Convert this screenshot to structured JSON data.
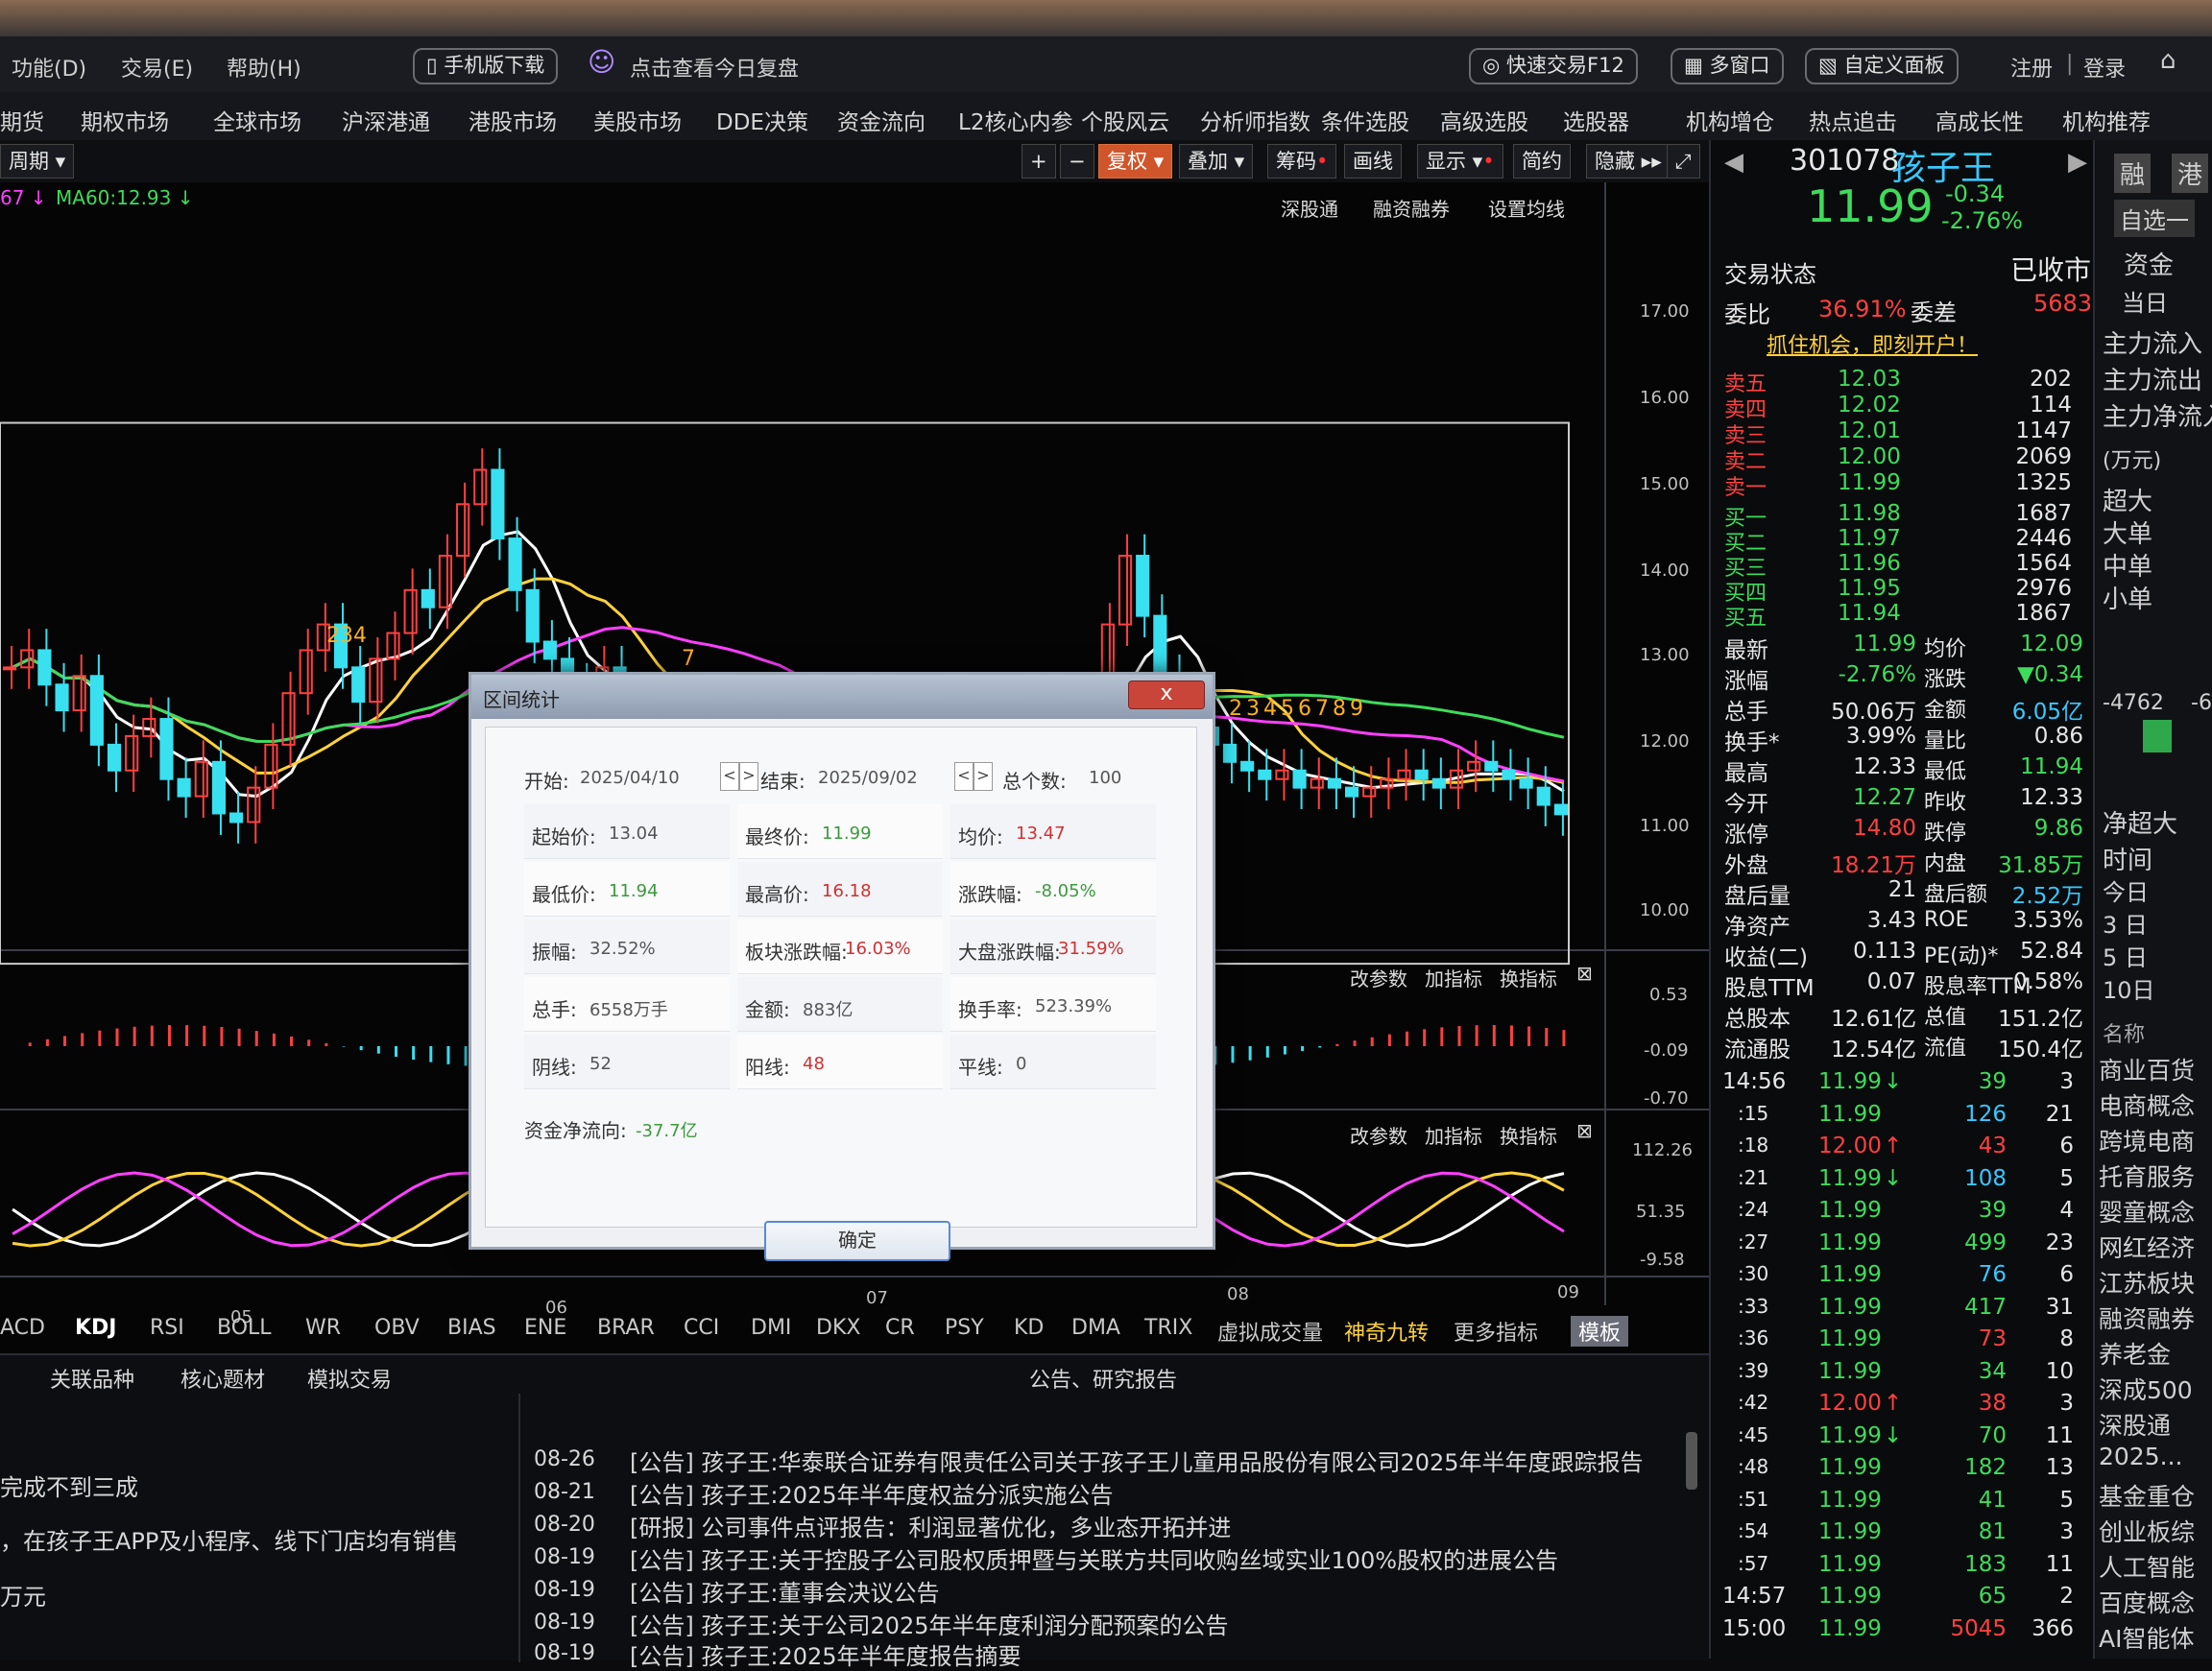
{
  "topmenu": {
    "func": "功能(D)",
    "trade": "交易(E)",
    "help": "帮助(H)",
    "mobile_download": "手机版下载",
    "review": "点击查看今日复盘",
    "quick_trade": "快速交易F12",
    "multi_window": "多窗口",
    "custom_panel": "自定义面板",
    "register": "注册",
    "login": "登录"
  },
  "nav": {
    "items": [
      "期货",
      "期权市场",
      "全球市场",
      "沪深港通",
      "港股市场",
      "美股市场",
      "DDE决策",
      "资金流向",
      "L2核心内参",
      "个股风云",
      "分析师指数",
      "条件选股",
      "高级选股",
      "选股器",
      "机构增仓",
      "热点追击",
      "高成长性",
      "机构推荐"
    ]
  },
  "toolbar": {
    "period": "周期",
    "fuquan": "复权",
    "overlay": "叠加",
    "chips": "筹码",
    "drawline": "画线",
    "display": "显示",
    "simple": "简约",
    "hide": "隐藏",
    "ma60": "MA60:12.93",
    "ma_prev": "67",
    "links": [
      "深股通",
      "融资融券",
      "设置均线"
    ]
  },
  "chart": {
    "price_ticks": [
      "17.00",
      "16.00",
      "15.00",
      "14.00",
      "13.00",
      "12.00",
      "11.00",
      "10.00"
    ],
    "macd_ticks": [
      "0.53",
      "-0.09",
      "-0.70"
    ],
    "kdj_ticks": [
      "112.26",
      "51.35",
      "-9.58"
    ],
    "x_ticks": [
      "05",
      "06",
      "07",
      "08",
      "09"
    ],
    "nine_turn_a": "234",
    "nine_turn_a2": "7",
    "nine_turn_b": "23456789",
    "sub_ops": [
      "改参数",
      "加指标",
      "换指标"
    ]
  },
  "indicator_tabs": [
    "ACD",
    "KDJ",
    "RSI",
    "BOLL",
    "WR",
    "OBV",
    "BIAS",
    "ENE",
    "BRAR",
    "CCI",
    "DMI",
    "DKX",
    "CR",
    "PSY",
    "KD",
    "DMA",
    "TRIX",
    "虚拟成交量",
    "神奇九转",
    "更多指标",
    "模板"
  ],
  "bottom": {
    "tabs": [
      "关联品种",
      "核心题材",
      "模拟交易"
    ],
    "left_text": [
      "完成不到三成",
      "，在孩子王APP及小程序、线下门店均有销售",
      "万元"
    ],
    "section_title": "公告、研究报告",
    "news": [
      {
        "date": "08-26",
        "text": "[公告] 孩子王:华泰联合证券有限责任公司关于孩子王儿童用品股份有限公司2025年半年度跟踪报告"
      },
      {
        "date": "08-21",
        "text": "[公告] 孩子王:2025年半年度权益分派实施公告"
      },
      {
        "date": "08-20",
        "text": "[研报] 公司事件点评报告：利润显著优化，多业态开拓并进"
      },
      {
        "date": "08-19",
        "text": "[公告] 孩子王:关于控股子公司股权质押暨与关联方共同收购丝域实业100%股权的进展公告"
      },
      {
        "date": "08-19",
        "text": "[公告] 孩子王:董事会决议公告"
      },
      {
        "date": "08-19",
        "text": "[公告] 孩子王:关于公司2025年半年度利润分配预案的公告"
      },
      {
        "date": "08-19",
        "text": "[公告] 孩子王:2025年半年度报告摘要"
      }
    ]
  },
  "stock": {
    "code": "301078",
    "name": "孩子王",
    "price": "11.99",
    "change": "-0.34",
    "change_pct": "-2.76%",
    "trade_status_label": "交易状态",
    "trade_status": "已收市",
    "weibi_label": "委比",
    "weibi": "36.91%",
    "weicha_label": "委差",
    "weicha": "5683",
    "promo": "抓住机会，即刻开户！",
    "asks": [
      {
        "label": "卖五",
        "price": "12.03",
        "vol": "202"
      },
      {
        "label": "卖四",
        "price": "12.02",
        "vol": "114"
      },
      {
        "label": "卖三",
        "price": "12.01",
        "vol": "1147"
      },
      {
        "label": "卖二",
        "price": "12.00",
        "vol": "2069"
      },
      {
        "label": "卖一",
        "price": "11.99",
        "vol": "1325"
      }
    ],
    "bids": [
      {
        "label": "买一",
        "price": "11.98",
        "vol": "1687"
      },
      {
        "label": "买二",
        "price": "11.97",
        "vol": "2446"
      },
      {
        "label": "买三",
        "price": "11.96",
        "vol": "1564"
      },
      {
        "label": "买四",
        "price": "11.95",
        "vol": "2976"
      },
      {
        "label": "买五",
        "price": "11.94",
        "vol": "1867"
      }
    ],
    "stats": [
      {
        "l1": "最新",
        "v1": "11.99",
        "l2": "均价",
        "v2": "12.09",
        "c1": "grn",
        "c2": "grn"
      },
      {
        "l1": "涨幅",
        "v1": "-2.76%",
        "l2": "涨跌",
        "v2": "▼0.34",
        "c1": "grn",
        "c2": "grn"
      },
      {
        "l1": "总手",
        "v1": "50.06万",
        "l2": "金额",
        "v2": "6.05亿",
        "c1": "wht",
        "c2": "cyan"
      },
      {
        "l1": "换手*",
        "v1": "3.99%",
        "l2": "量比",
        "v2": "0.86",
        "c1": "wht",
        "c2": "wht"
      },
      {
        "l1": "最高",
        "v1": "12.33",
        "l2": "最低",
        "v2": "11.94",
        "c1": "wht",
        "c2": "grn"
      },
      {
        "l1": "今开",
        "v1": "12.27",
        "l2": "昨收",
        "v2": "12.33",
        "c1": "grn",
        "c2": "wht"
      },
      {
        "l1": "涨停",
        "v1": "14.80",
        "l2": "跌停",
        "v2": "9.86",
        "c1": "red",
        "c2": "grn"
      },
      {
        "l1": "外盘",
        "v1": "18.21万",
        "l2": "内盘",
        "v2": "31.85万",
        "c1": "red",
        "c2": "grn"
      },
      {
        "l1": "盘后量",
        "v1": "21",
        "l2": "盘后额",
        "v2": "2.52万",
        "c1": "wht",
        "c2": "cyan"
      },
      {
        "l1": "净资产",
        "v1": "3.43",
        "l2": "ROE",
        "v2": "3.53%",
        "c1": "wht",
        "c2": "wht"
      },
      {
        "l1": "收益(二)",
        "v1": "0.113",
        "l2": "PE(动)*",
        "v2": "52.84",
        "c1": "wht",
        "c2": "wht"
      },
      {
        "l1": "股息TTM",
        "v1": "0.07",
        "l2": "股息率TTM",
        "v2": "0.58%",
        "c1": "wht",
        "c2": "wht"
      },
      {
        "l1": "总股本",
        "v1": "12.61亿",
        "l2": "总值",
        "v2": "151.2亿",
        "c1": "wht",
        "c2": "wht"
      },
      {
        "l1": "流通股",
        "v1": "12.54亿",
        "l2": "流值",
        "v2": "150.4亿",
        "c1": "wht",
        "c2": "wht"
      }
    ],
    "ticks": [
      {
        "t": "14:56",
        "p": "11.99",
        "a": "↓",
        "v": "39",
        "n": "3",
        "pc": "grn",
        "vc": "grn"
      },
      {
        "t": ":15",
        "p": "11.99",
        "a": "",
        "v": "126",
        "n": "21",
        "pc": "grn",
        "vc": "cyan"
      },
      {
        "t": ":18",
        "p": "12.00",
        "a": "↑",
        "v": "43",
        "n": "6",
        "pc": "red",
        "vc": "red"
      },
      {
        "t": ":21",
        "p": "11.99",
        "a": "↓",
        "v": "108",
        "n": "5",
        "pc": "grn",
        "vc": "cyan"
      },
      {
        "t": ":24",
        "p": "11.99",
        "a": "",
        "v": "39",
        "n": "4",
        "pc": "grn",
        "vc": "grn"
      },
      {
        "t": ":27",
        "p": "11.99",
        "a": "",
        "v": "499",
        "n": "23",
        "pc": "grn",
        "vc": "grn"
      },
      {
        "t": ":30",
        "p": "11.99",
        "a": "",
        "v": "76",
        "n": "6",
        "pc": "grn",
        "vc": "cyan"
      },
      {
        "t": ":33",
        "p": "11.99",
        "a": "",
        "v": "417",
        "n": "31",
        "pc": "grn",
        "vc": "grn"
      },
      {
        "t": ":36",
        "p": "11.99",
        "a": "",
        "v": "73",
        "n": "8",
        "pc": "grn",
        "vc": "red"
      },
      {
        "t": ":39",
        "p": "11.99",
        "a": "",
        "v": "34",
        "n": "10",
        "pc": "grn",
        "vc": "grn"
      },
      {
        "t": ":42",
        "p": "12.00",
        "a": "↑",
        "v": "38",
        "n": "3",
        "pc": "red",
        "vc": "red"
      },
      {
        "t": ":45",
        "p": "11.99",
        "a": "↓",
        "v": "70",
        "n": "11",
        "pc": "grn",
        "vc": "grn"
      },
      {
        "t": ":48",
        "p": "11.99",
        "a": "",
        "v": "182",
        "n": "13",
        "pc": "grn",
        "vc": "grn"
      },
      {
        "t": ":51",
        "p": "11.99",
        "a": "",
        "v": "41",
        "n": "5",
        "pc": "grn",
        "vc": "grn"
      },
      {
        "t": ":54",
        "p": "11.99",
        "a": "",
        "v": "81",
        "n": "3",
        "pc": "grn",
        "vc": "grn"
      },
      {
        "t": ":57",
        "p": "11.99",
        "a": "",
        "v": "183",
        "n": "11",
        "pc": "grn",
        "vc": "grn"
      },
      {
        "t": "14:57",
        "p": "11.99",
        "a": "",
        "v": "65",
        "n": "2",
        "pc": "grn",
        "vc": "grn"
      },
      {
        "t": "15:00",
        "p": "11.99",
        "a": "",
        "v": "5045",
        "n": "366",
        "pc": "grn",
        "vc": "red"
      }
    ]
  },
  "farright": {
    "btn1": "融",
    "btn2": "港",
    "zixuan": "自选一",
    "tab1": "资金",
    "tab2": "当日",
    "flows": [
      "主力流入",
      "主力流出",
      "主力净流入"
    ],
    "unit": "(万元)",
    "sizes": [
      "超大",
      "大单",
      "中单",
      "小单"
    ],
    "bar_value": "-4762",
    "bar_value2": "-6",
    "net_label": "净超大",
    "time_label": "时间",
    "periods": [
      "今日",
      "3 日",
      "5 日",
      "10日"
    ],
    "name_label": "名称",
    "concepts": [
      "商业百货",
      "电商概念",
      "跨境电商",
      "托育服务",
      "婴童概念",
      "网红经济",
      "江苏板块",
      "融资融券",
      "养老金",
      "深成500",
      "深股通",
      "2025...",
      "基金重仓",
      "创业板综",
      "人工智能",
      "百度概念",
      "AI智能体"
    ]
  },
  "dialog": {
    "title": "区间统计",
    "close": "x",
    "start_label": "开始:",
    "start": "2025/04/10",
    "end_label": "结束:",
    "end": "2025/09/02",
    "count_label": "总个数:",
    "count": "100",
    "rows": [
      [
        {
          "l": "起始价:",
          "v": "13.04",
          "c": ""
        },
        {
          "l": "最终价:",
          "v": "11.99",
          "c": "neg"
        },
        {
          "l": "均价:",
          "v": "13.47",
          "c": "pos"
        }
      ],
      [
        {
          "l": "最低价:",
          "v": "11.94",
          "c": "neg"
        },
        {
          "l": "最高价:",
          "v": "16.18",
          "c": "pos"
        },
        {
          "l": "涨跌幅:",
          "v": "-8.05%",
          "c": "neg"
        }
      ],
      [
        {
          "l": "振幅:",
          "v": "32.52%",
          "c": ""
        },
        {
          "l": "板块涨跌幅:",
          "v": "16.03%",
          "c": "pos"
        },
        {
          "l": "大盘涨跌幅:",
          "v": "31.59%",
          "c": "pos"
        }
      ],
      [
        {
          "l": "总手:",
          "v": "6558万手",
          "c": ""
        },
        {
          "l": "金额:",
          "v": "883亿",
          "c": ""
        },
        {
          "l": "换手率:",
          "v": "523.39%",
          "c": ""
        }
      ],
      [
        {
          "l": "阴线:",
          "v": "52",
          "c": ""
        },
        {
          "l": "阳线:",
          "v": "48",
          "c": "pos"
        },
        {
          "l": "平线:",
          "v": "0",
          "c": ""
        }
      ]
    ],
    "net_label": "资金净流向:",
    "net": "-37.7亿",
    "ok": "确定"
  }
}
